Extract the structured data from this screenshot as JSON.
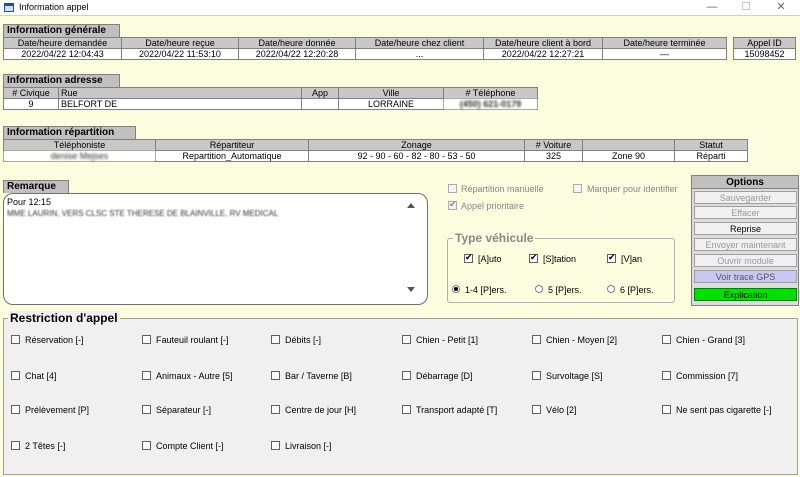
{
  "window": {
    "title": "Information appel",
    "min_glyph": "—",
    "max_glyph": "☐",
    "close_glyph": "✕"
  },
  "info_generale": {
    "title": "Information générale",
    "headers": [
      "Date/heure demandée",
      "Date/heure reçue",
      "Date/heure donnée",
      "Date/heure chez client",
      "Date/heure client à bord",
      "Date/heure terminée"
    ],
    "values": [
      "2022/04/22 12:04:43",
      "2022/04/22 11:53:10",
      "2022/04/22 12:20:28",
      "...",
      "2022/04/22 12:27:21",
      "—"
    ],
    "appel_id_label": "Appel ID",
    "appel_id": "15098452"
  },
  "info_adresse": {
    "title": "Information adresse",
    "headers": [
      "# Civique",
      "Rue",
      "App",
      "Ville",
      "# Téléphone"
    ],
    "values": [
      "9",
      "BELFORT DE",
      "",
      "LORRAINE",
      "(450) 621-0179"
    ]
  },
  "info_repartition": {
    "title": "Information répartition",
    "headers": [
      "Téléphoniste",
      "Répartiteur",
      "Zonage",
      "# Voiture",
      "",
      "Statut"
    ],
    "values": [
      "denise Mejses",
      "Repartition_Automatique",
      "92 - 90 - 60 - 82 - 80 - 53 - 50",
      "325",
      "Zone 90",
      "Réparti"
    ]
  },
  "remarque": {
    "title": "Remarque",
    "line1": "Pour 12:15",
    "line2": "MME LAURIN, VERS CLSC STE THERESE DE BLAINVILLE, RV MEDICAL"
  },
  "flags": {
    "repartition_manuelle": "Répartition manuelle",
    "appel_prioritaire": "Appel prioritaire",
    "marquer_identifier": "Marquer pour identifier"
  },
  "type_vehicule": {
    "title": "Type véhicule",
    "auto": "[A]uto",
    "station": "[S]tation",
    "van": "[V]an",
    "p4": "1-4 [P]ers.",
    "p5": "5 [P]ers.",
    "p6": "6 [P]ers."
  },
  "options": {
    "title": "Options",
    "sauvegarder": "Sauvegarder",
    "effacer": "Effacer",
    "reprise": "Reprise",
    "envoyer": "Envoyer maintenant",
    "ouvrir": "Ouvrir module",
    "gps": "Voir trace GPS",
    "explication": "Explication",
    "explication_color": "#00e000"
  },
  "restriction": {
    "title": "Restriction d'appel",
    "items": [
      "Réservation [-]",
      "Fauteuil roulant [-]",
      "Débits [-]",
      "Chien - Petit [1]",
      "Chien - Moyen [2]",
      "Chien - Grand [3]",
      "Chat [4]",
      "Animaux - Autre [5]",
      "Bar / Taverne [B]",
      "Débarrage [D]",
      "Survoltage [S]",
      "Commission [7]",
      "Prélèvement [P]",
      "Séparateur [-]",
      "Centre de jour [H]",
      "Transport adapté [T]",
      "Vélo [2]",
      "Ne sent pas cigarette [-]",
      "2 Têtes [-]",
      "Compte Client [-]",
      "Livraison [-]"
    ]
  }
}
